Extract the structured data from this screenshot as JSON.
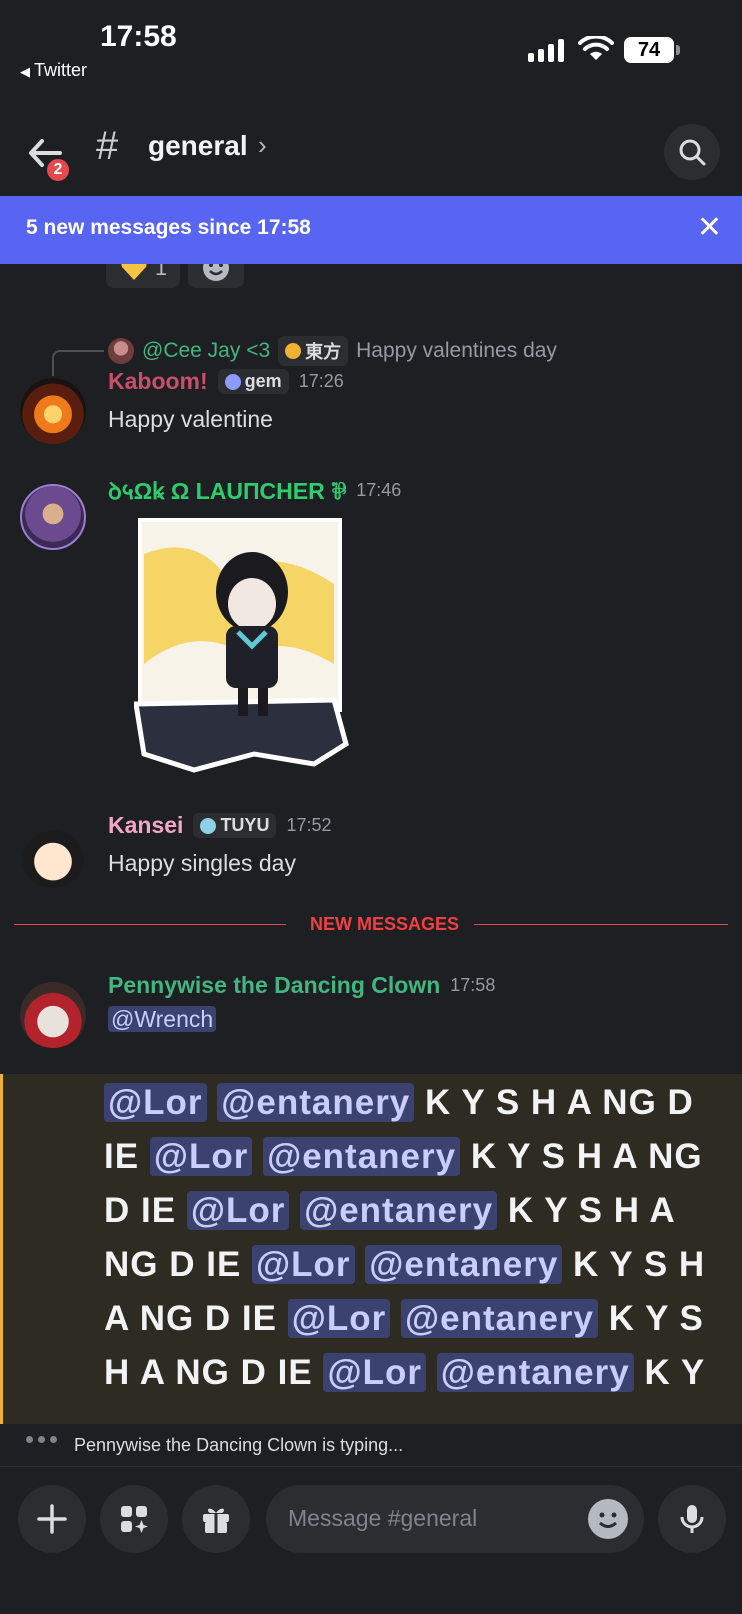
{
  "status_bar": {
    "time": "17:58",
    "back_app": "Twitter",
    "battery": "74"
  },
  "header": {
    "channel_name": "general",
    "back_badge": "2"
  },
  "banner": {
    "text": "5 new messages since 17:58",
    "close": "✕"
  },
  "reactions": [
    {
      "emoji": "yellow-heart",
      "count": "1"
    },
    {
      "emoji": "add-reaction"
    }
  ],
  "reply": {
    "name": "@Cee Jay <3",
    "tag": "東方",
    "text": "Happy valentines day"
  },
  "messages": [
    {
      "name": "Kaboom!",
      "name_color": "#c94f6a",
      "tag": "gem",
      "time": "17:26",
      "text": "Happy valentine"
    },
    {
      "name": "ꝺ५Ωꝃ Ω LAUΠCHER ⅌",
      "name_color": "#2ecc71",
      "time": "17:46"
    },
    {
      "name": "Kansei",
      "name_color": "#f4a6c8",
      "tag": "TUYU",
      "time": "17:52",
      "text": "Happy singles day"
    },
    {
      "name": "Pennywise the Dancing Clown",
      "name_color": "#43b581",
      "time": "17:58",
      "mention": "@Wrench"
    }
  ],
  "divider": {
    "label": "NEW MESSAGES"
  },
  "spam": {
    "m1": "@Lor",
    "m2": "@entanery",
    "t1": "K Y S H A NG D",
    "t2": "IE",
    "t3": "K Y S H A NG",
    "t4": "D IE",
    "t5": "K Y S H A",
    "t6": "NG D IE",
    "t7": "K Y S H",
    "t8": "A NG D IE",
    "t9": "K Y S",
    "t10": "H A NG D IE",
    "t11": "K Y"
  },
  "typing": {
    "text": "Pennywise the Dancing Clown is typing..."
  },
  "composer": {
    "placeholder": "Message #general"
  }
}
